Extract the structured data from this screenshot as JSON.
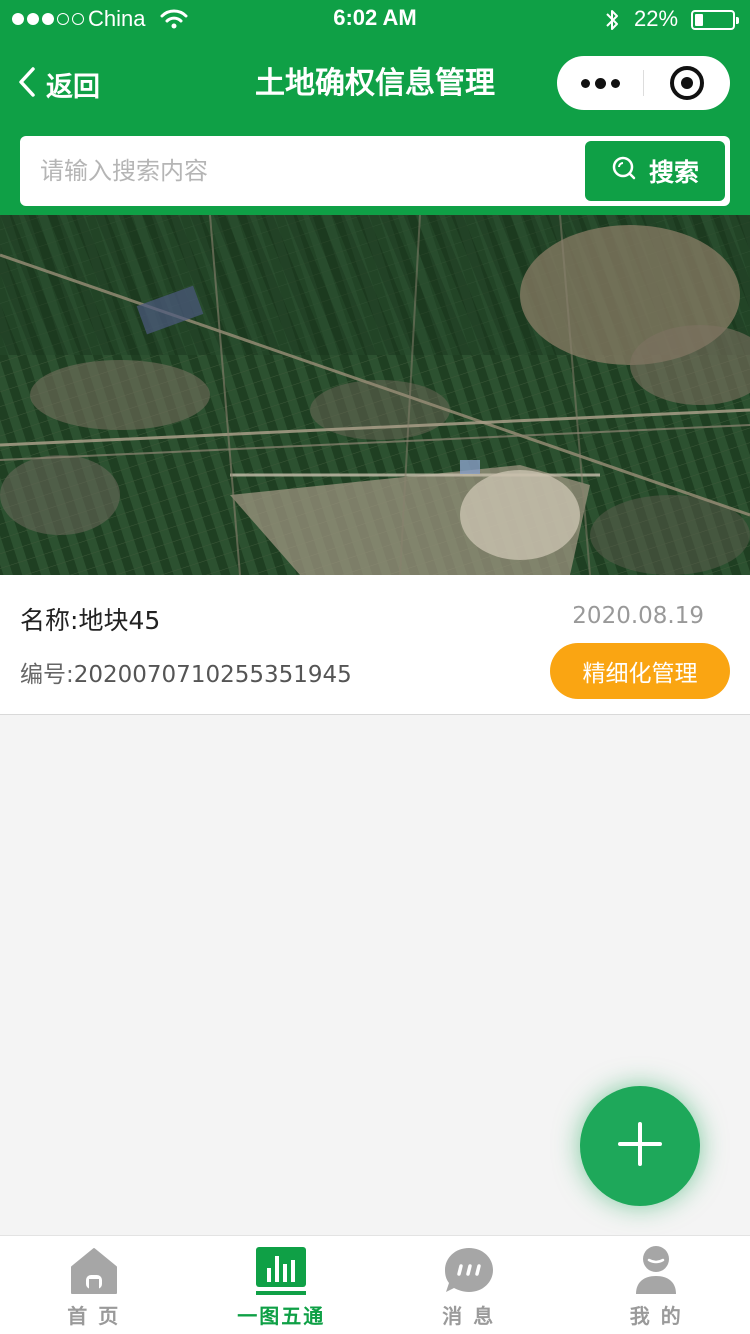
{
  "status_bar": {
    "carrier": "China",
    "time": "6:02 AM",
    "battery": "22%",
    "battery_level": 0.22
  },
  "nav": {
    "back_label": "返回",
    "title": "土地确权信息管理"
  },
  "search": {
    "placeholder": "请输入搜索内容",
    "button_label": "搜索"
  },
  "record": {
    "name_label": "名称:",
    "name_value": "地块45",
    "id_label": "编号:",
    "id_value": "2020070710255351945",
    "date": "2020.08.19",
    "action_label": "精细化管理"
  },
  "tabs": [
    {
      "label": "首 页",
      "icon": "home-icon",
      "active": false
    },
    {
      "label": "一图五通",
      "icon": "chart-icon",
      "active": true
    },
    {
      "label": "消 息",
      "icon": "message-icon",
      "active": false
    },
    {
      "label": "我 的",
      "icon": "user-icon",
      "active": false
    }
  ],
  "colors": {
    "brand_green": "#0fa046",
    "action_orange": "#faa512",
    "fab_green": "#1ea85a",
    "inactive_gray": "#9a9a9a"
  }
}
